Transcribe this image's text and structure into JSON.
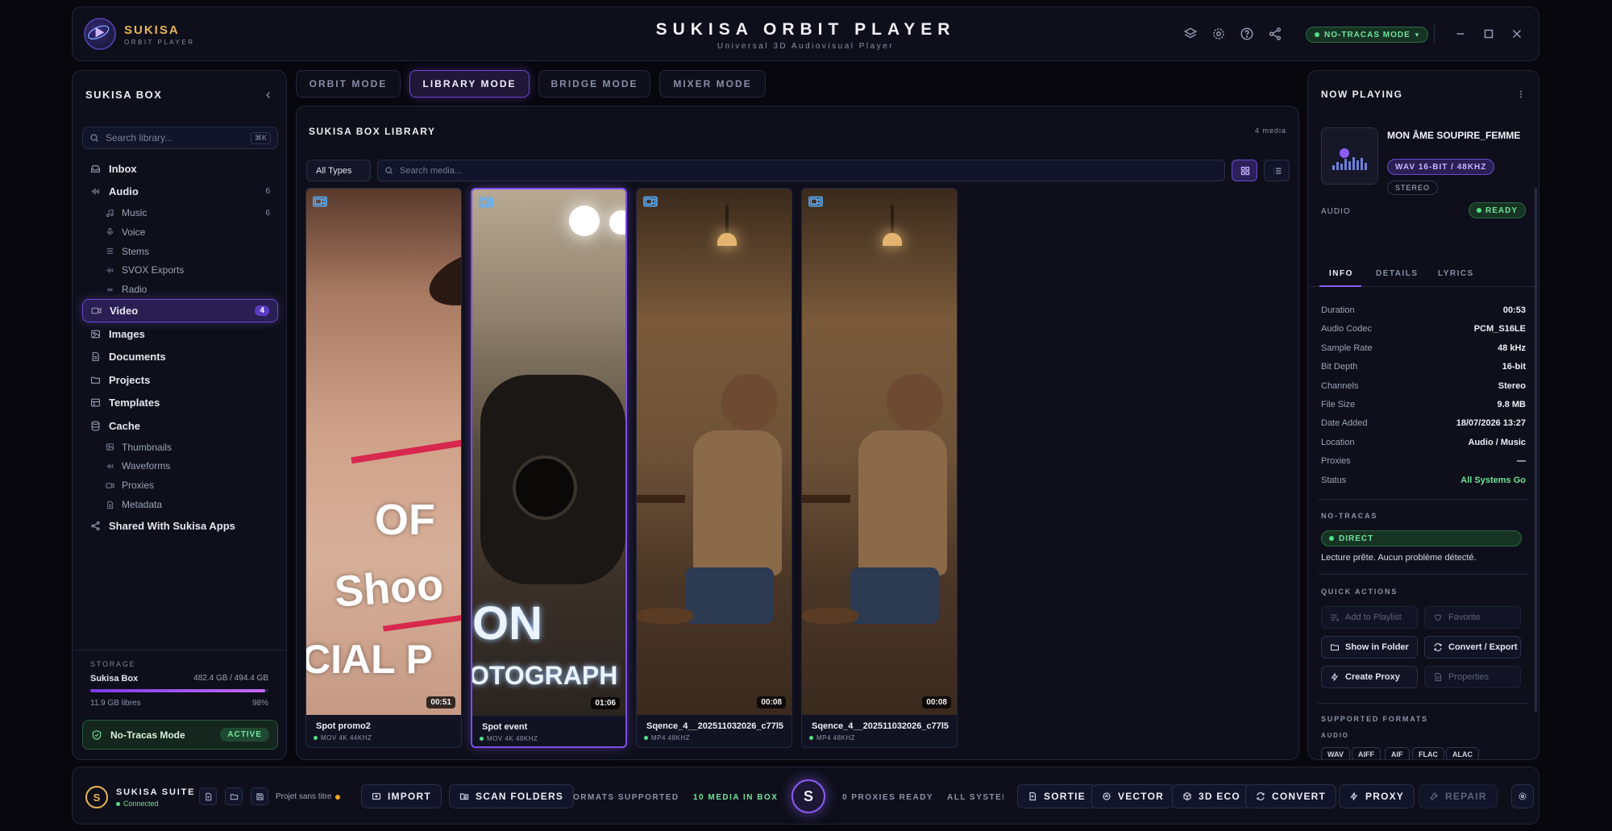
{
  "header": {
    "brand": "SUKISA",
    "brand_sub": "ORBIT PLAYER",
    "title": "SUKISA ORBIT PLAYER",
    "subtitle": "Universal 3D Audiovisual Player",
    "mode_pill": "NO-TRACAS MODE",
    "icons": [
      "layers-icon",
      "settings-icon",
      "help-icon",
      "share-icon",
      "minimize-icon",
      "maximize-icon",
      "close-icon"
    ]
  },
  "sidebar": {
    "title": "SUKISA BOX",
    "search_placeholder": "Search library...",
    "search_shortcut": "⌘K",
    "items": [
      {
        "label": "Inbox",
        "count": "",
        "icon": "inbox-icon",
        "level": 0
      },
      {
        "label": "Audio",
        "count": "6",
        "icon": "waveform-icon",
        "level": 0
      },
      {
        "label": "Music",
        "count": "6",
        "icon": "music-icon",
        "level": 1
      },
      {
        "label": "Voice",
        "count": "",
        "icon": "mic-icon",
        "level": 1
      },
      {
        "label": "Stems",
        "count": "",
        "icon": "stems-icon",
        "level": 1
      },
      {
        "label": "SVOX Exports",
        "count": "",
        "icon": "waveform-icon",
        "level": 1
      },
      {
        "label": "Radio",
        "count": "",
        "icon": "radio-icon",
        "level": 1
      },
      {
        "label": "Video",
        "count": "4",
        "icon": "video-icon",
        "level": 0,
        "active": true
      },
      {
        "label": "Images",
        "count": "",
        "icon": "image-icon",
        "level": 0
      },
      {
        "label": "Documents",
        "count": "",
        "icon": "document-icon",
        "level": 0
      },
      {
        "label": "Projects",
        "count": "",
        "icon": "folder-icon",
        "level": 0
      },
      {
        "label": "Templates",
        "count": "",
        "icon": "template-icon",
        "level": 0
      },
      {
        "label": "Cache",
        "count": "",
        "icon": "database-icon",
        "level": 0
      },
      {
        "label": "Thumbnails",
        "count": "",
        "icon": "image-icon",
        "level": 1
      },
      {
        "label": "Waveforms",
        "count": "",
        "icon": "waveform-icon",
        "level": 1
      },
      {
        "label": "Proxies",
        "count": "",
        "icon": "video-icon",
        "level": 1
      },
      {
        "label": "Metadata",
        "count": "",
        "icon": "document-icon",
        "level": 1
      },
      {
        "label": "Shared With Sukisa Apps",
        "count": "",
        "icon": "share-icon",
        "level": 0
      }
    ],
    "storage": {
      "label": "STORAGE",
      "name": "Sukisa Box",
      "size": "482.4 GB / 494.4 GB",
      "free": "11.9 GB libres",
      "percent_text": "98%",
      "fill_fraction": 0.98
    },
    "notracas": {
      "label": "No-Tracas Mode",
      "badge": "ACTIVE"
    }
  },
  "modes": {
    "tabs": [
      {
        "label": "ORBIT MODE",
        "active": false
      },
      {
        "label": "LIBRARY MODE",
        "active": true
      },
      {
        "label": "BRIDGE MODE",
        "active": false
      },
      {
        "label": "MIXER MODE",
        "active": false
      }
    ]
  },
  "library": {
    "title": "SUKISA BOX LIBRARY",
    "count": "4 media",
    "type_filter": "All Types",
    "search_placeholder": "Search media...",
    "cards": [
      {
        "name": "Spot promo2",
        "meta": "MOV 4K 44KHZ",
        "duration": "00:51",
        "selected": false
      },
      {
        "name": "Spot event",
        "meta": "MOV 4K 48KHZ",
        "duration": "01:06",
        "selected": true
      },
      {
        "name": "Sqence_4__202511032026_c77l5",
        "meta": "MP4 48KHZ",
        "duration": "00:08",
        "selected": false
      },
      {
        "name": "Sqence_4__202511032026_c77l5",
        "meta": "MP4 48KHZ",
        "duration": "00:08",
        "selected": false
      }
    ],
    "thumb_text": {
      "promo_1": "OF",
      "promo_2": "Shoo",
      "promo_3": "CIAL P",
      "event_1": "ON",
      "event_2": "OTOGRAPH"
    }
  },
  "now_playing": {
    "title": "NOW PLAYING",
    "track": "MON ÂME SOUPIRE_FEMME",
    "format": "WAV 16-BIT / 48KHZ",
    "channels_pill": "STEREO",
    "type": "AUDIO",
    "status_pill": "READY",
    "tabs": [
      "INFO",
      "DETAILS",
      "LYRICS"
    ],
    "info": [
      {
        "k": "Duration",
        "v": "00:53"
      },
      {
        "k": "Audio Codec",
        "v": "PCM_S16LE"
      },
      {
        "k": "Sample Rate",
        "v": "48 kHz"
      },
      {
        "k": "Bit Depth",
        "v": "16-bit"
      },
      {
        "k": "Channels",
        "v": "Stereo"
      },
      {
        "k": "File Size",
        "v": "9.8 MB"
      },
      {
        "k": "Date Added",
        "v": "18/07/2026 13:27"
      },
      {
        "k": "Location",
        "v": "Audio / Music"
      },
      {
        "k": "Proxies",
        "v": "—"
      },
      {
        "k": "Status",
        "v": "All Systems Go"
      }
    ],
    "notracas_label": "NO-TRACAS",
    "direct_pill": "DIRECT",
    "note": "Lecture prête. Aucun problème détecté.",
    "quick_actions_label": "QUICK ACTIONS",
    "quick_actions": [
      {
        "label": "Add to Playlist",
        "enabled": false,
        "icon": "playlist-icon"
      },
      {
        "label": "Favorite",
        "enabled": false,
        "icon": "heart-icon"
      },
      {
        "label": "Show in Folder",
        "enabled": true,
        "icon": "folder-icon"
      },
      {
        "label": "Convert / Export",
        "enabled": true,
        "icon": "convert-icon"
      },
      {
        "label": "Create Proxy",
        "enabled": true,
        "icon": "bolt-icon"
      },
      {
        "label": "Properties",
        "enabled": false,
        "icon": "document-icon"
      }
    ],
    "supported_label": "SUPPORTED FORMATS",
    "supported_audio_label": "AUDIO",
    "audio_formats": [
      "WAV",
      "AIFF",
      "AIF",
      "FLAC",
      "ALAC"
    ]
  },
  "bottom": {
    "suite_initial": "S",
    "suite_name": "SUKISA SUITE",
    "suite_status": "Connected",
    "project": "Projet sans titre",
    "import": "IMPORT",
    "scan": "SCAN FOLDERS",
    "ticker_1": "ORMATS SUPPORTED",
    "ticker_2": "10 MEDIA IN BOX",
    "center_initial": "S",
    "ticker_3": "0 PROXIES READY",
    "ticker_4": "ALL SYSTEMS",
    "sortie": "SORTIE",
    "vector": "VECTOR",
    "eco": "3D ECO",
    "convert": "CONVERT",
    "proxy": "PROXY",
    "repair": "REPAIR"
  },
  "colors": {
    "accent": "#8b5cf6",
    "brand_gold": "#e8b458",
    "success": "#53e08a",
    "background": "#07070d",
    "panel": "#0e0f1a"
  }
}
